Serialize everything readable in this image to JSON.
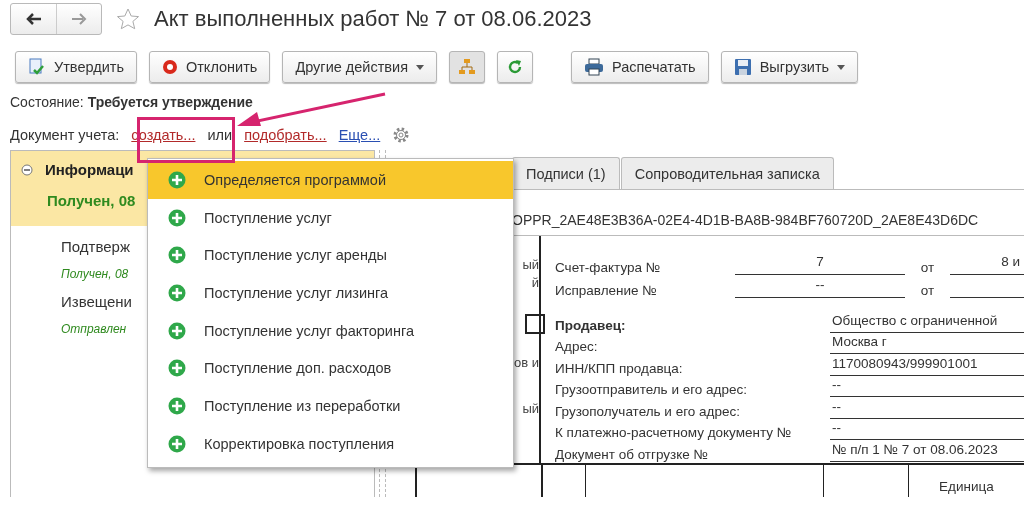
{
  "title": "Акт выполненных работ № 7 от 08.06.2023",
  "toolbar": [
    {
      "kind": "approve",
      "label": "Утвердить",
      "dropdown": false
    },
    {
      "kind": "reject",
      "label": "Отклонить",
      "dropdown": false
    },
    {
      "kind": "text",
      "label": "Другие действия",
      "dropdown": true
    },
    {
      "kind": "structure",
      "dropdown": false
    },
    {
      "kind": "refresh",
      "dropdown": false
    },
    {
      "kind": "print",
      "label": "Распечатать",
      "dropdown": false
    },
    {
      "kind": "save",
      "label": "Выгрузить",
      "dropdown": true
    }
  ],
  "state": {
    "label": "Состояние:",
    "value": "Требуется утверждение"
  },
  "account_doc": {
    "label": "Документ учета:",
    "create_link": "создать...",
    "separator": "или",
    "pick_link": "подобрать...",
    "more_link": "Еще..."
  },
  "dropdown": {
    "items": [
      {
        "label": "Определяется программой",
        "selected": true
      },
      {
        "label": "Поступление услуг",
        "selected": false
      },
      {
        "label": "Поступление услуг аренды",
        "selected": false
      },
      {
        "label": "Поступление услуг лизинга",
        "selected": false
      },
      {
        "label": "Поступление услуг факторинга",
        "selected": false
      },
      {
        "label": "Поступление доп. расходов",
        "selected": false
      },
      {
        "label": "Поступление из переработки",
        "selected": false
      },
      {
        "label": "Корректировка поступления",
        "selected": false
      }
    ]
  },
  "left_panel": {
    "header": {
      "expanded": true,
      "title": "Информаци",
      "status": "Получен, 08"
    },
    "items": [
      {
        "title": "Подтверж",
        "status": "Получен, 08"
      },
      {
        "title": "Извещени",
        "status": "Отправлен"
      }
    ]
  },
  "tabs": [
    {
      "label": "Подписи (1)",
      "selected": false
    },
    {
      "label": "Сопроводительная записка",
      "selected": false
    }
  ],
  "file_id": "OPPR_2AE48E3B36A-02E4-4D1B-BA8B-984BF760720D_2AE8E43D6DC",
  "document": {
    "left_fragments": [
      "ый",
      "й",
      "ов и",
      "ый"
    ],
    "invoice_rows": [
      {
        "label": "Счет-фактура №",
        "number": "7",
        "date_label": "от",
        "date": "8 и"
      },
      {
        "label": "Исправление №",
        "number": "--",
        "date_label": "от"
      }
    ],
    "fields": [
      {
        "label": "Продавец:",
        "value": "Общество с ограниченной",
        "bold": true
      },
      {
        "label": "Адрес:",
        "value": "Москва г",
        "bold": false
      },
      {
        "label": "ИНН/КПП продавца:",
        "value": "1170080943/999901001",
        "bold": false
      },
      {
        "label": "Грузоотправитель и его адрес:",
        "value": "--",
        "bold": false
      },
      {
        "label": "Грузополучатель и его адрес:",
        "value": "--",
        "bold": false
      },
      {
        "label": "К платежно-расчетному документу №",
        "value": "--",
        "bold": false
      },
      {
        "label": "Документ об отгрузке №",
        "value": "№ п/п 1 № 7 от 08.06.2023",
        "bold": false
      }
    ],
    "table_header": [
      "Единица"
    ]
  }
}
